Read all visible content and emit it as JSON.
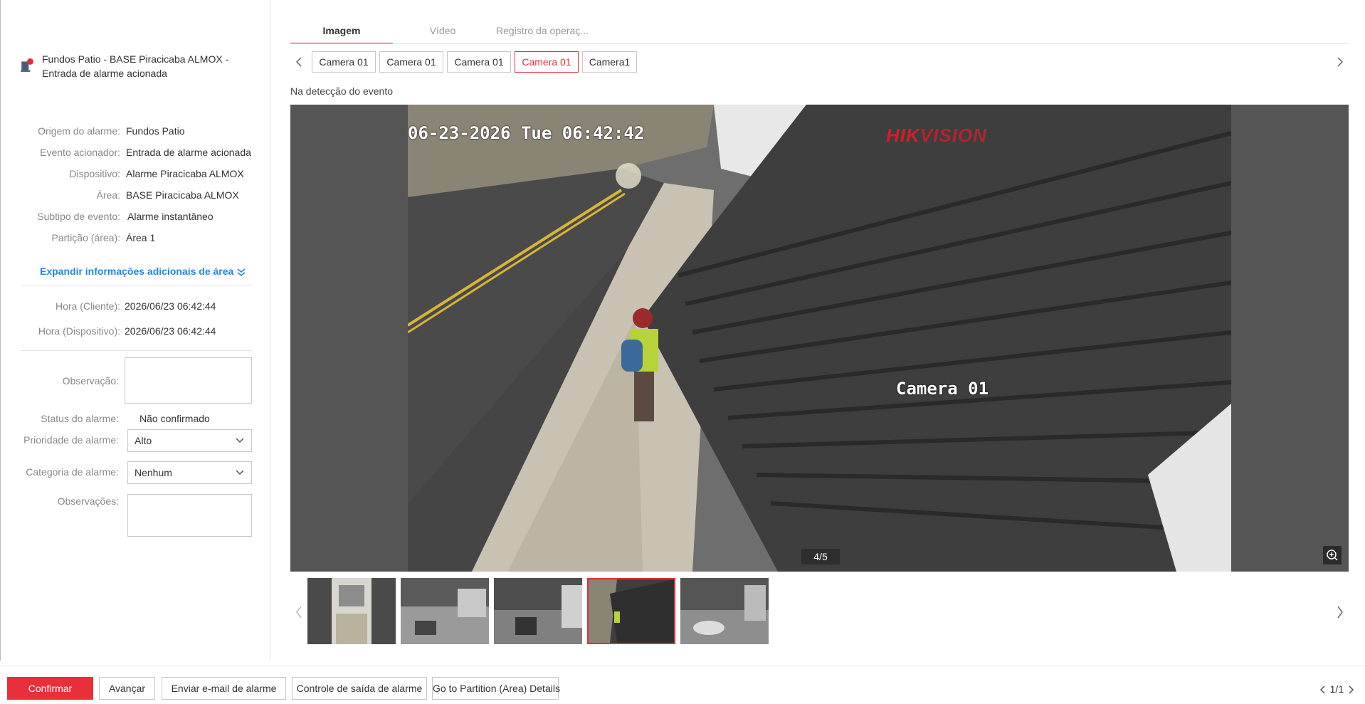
{
  "alarm": {
    "title": "Fundos Patio - BASE Piracicaba ALMOX - Entrada de alarme acionada"
  },
  "details": [
    {
      "label": "Origem do alarme:",
      "value": "Fundos Patio"
    },
    {
      "label": "Evento acionador:",
      "value": "Entrada de alarme acionada"
    },
    {
      "label": "Dispositivo:",
      "value": "Alarme Piracicaba ALMOX"
    },
    {
      "label": "Área:",
      "value": "BASE Piracicaba ALMOX"
    },
    {
      "label": "Subtipo de evento:",
      "value": "Alarme instantâneo"
    },
    {
      "label": "Partição (área):",
      "value": "Área 1"
    }
  ],
  "expand_link": "Expandir informações adicionais de área",
  "times": [
    {
      "label": "Hora (Cliente):",
      "value": "2026/06/23 06:42:44"
    },
    {
      "label": "Hora (Dispositivo):",
      "value": "2026/06/23 06:42:44"
    }
  ],
  "form": {
    "observacao_label": "Observação:",
    "observacao_value": "",
    "status_label": "Status do alarme:",
    "status_value": "Não confirmado",
    "priority_label": "Prioridade de alarme:",
    "priority_value": "Alto",
    "category_label": "Categoria de alarme:",
    "category_value": "Nenhum",
    "observacoes_label": "Observações:",
    "observacoes_value": ""
  },
  "tabs": [
    {
      "label": "Imagem",
      "active": true
    },
    {
      "label": "Vídeo",
      "active": false
    },
    {
      "label": "Registro da operaç...",
      "active": false
    }
  ],
  "camera_tabs": [
    {
      "label": "Camera 01",
      "active": false
    },
    {
      "label": "Camera 01",
      "active": false
    },
    {
      "label": "Camera 01",
      "active": false
    },
    {
      "label": "Camera 01",
      "active": true
    },
    {
      "label": "Camera1",
      "active": false
    }
  ],
  "detection_label": "Na detecção do evento",
  "viewer": {
    "timestamp_overlay": "06-23-2026 Tue 06:42:42",
    "brand_overlay_part1": "HIK",
    "brand_overlay_part2": "VISION",
    "camera_overlay": "Camera 01",
    "counter": "4/5"
  },
  "thumbnails_active_index": 3,
  "buttons": {
    "confirm": "Confirmar",
    "next": "Avançar",
    "email": "Enviar e-mail de alarme",
    "output": "Controle de saída de alarme",
    "partition": "Go to Partition (Area) Details"
  },
  "pager": "1/1",
  "colors": {
    "accent": "#e0303b",
    "link": "#1e88e5"
  }
}
